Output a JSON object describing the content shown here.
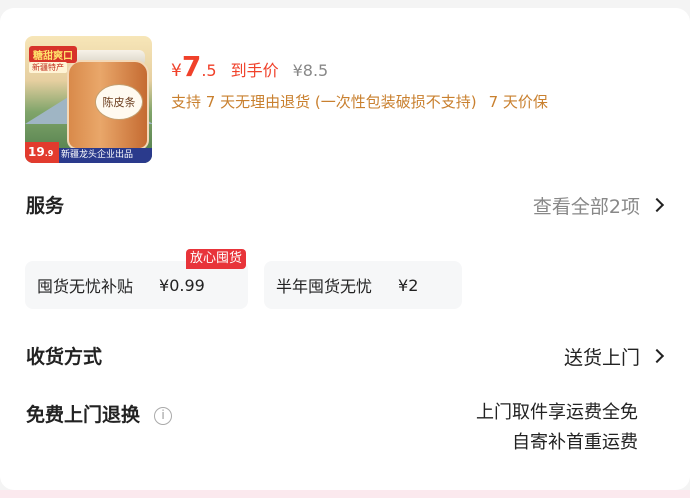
{
  "product": {
    "image_badge": "糖甜爽口",
    "image_subbadge": "新疆特产",
    "image_jar_label": "陈皮条",
    "image_price": "19",
    "image_price_decimal": ".9",
    "image_strip_text": "新疆龙头企业出品",
    "price_symbol": "¥",
    "price_integer": "7",
    "price_decimal": ".5",
    "price_label": "到手价",
    "original_price": "¥8.5",
    "policy_return": "支持 7 天无理由退货 (一次性包装破损不支持)",
    "policy_protect": "7 天价保",
    "colors": {
      "accent": "#f0412a",
      "policy": "#c9802f"
    }
  },
  "services": {
    "title": "服务",
    "view_all": "查看全部2项",
    "items": [
      {
        "label": "囤货无忧补贴",
        "price": "¥0.99",
        "tag": "放心囤货"
      },
      {
        "label": "半年囤货无忧",
        "price": "¥2"
      }
    ]
  },
  "delivery": {
    "title": "收货方式",
    "value": "送货上门"
  },
  "free_return": {
    "title": "免费上门退换",
    "info_icon": "i",
    "line1": "上门取件享运费全免",
    "line2": "自寄补首重运费"
  }
}
